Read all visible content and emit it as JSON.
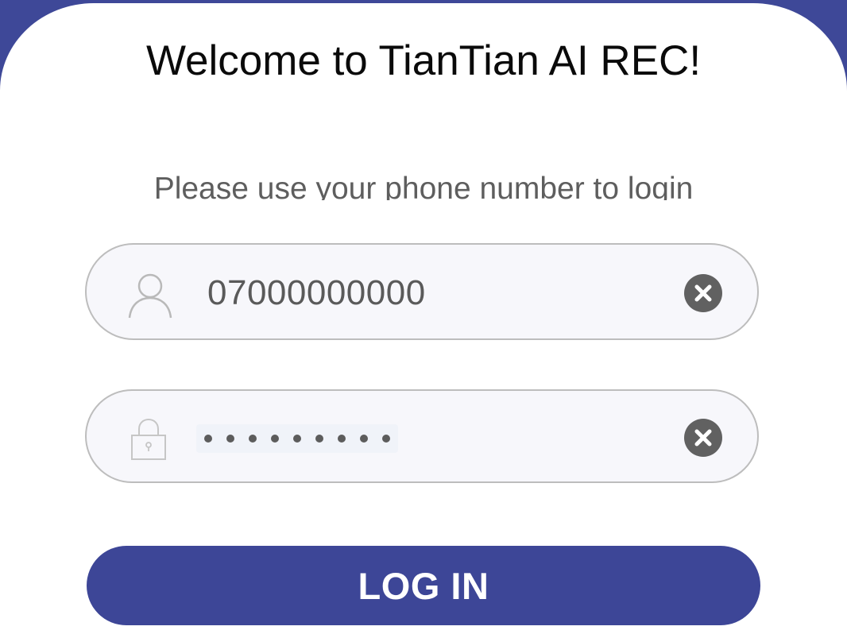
{
  "header": {
    "title": "Welcome to TianTian AI REC!",
    "subtitle": "Please use your phone number to login"
  },
  "phone_field": {
    "icon": "user-icon",
    "value": "07000000000",
    "clear_icon": "clear-icon"
  },
  "password_field": {
    "icon": "lock-icon",
    "masked_value": "•••••••••",
    "mask_length": 9,
    "clear_icon": "clear-icon"
  },
  "login_button": {
    "label": "LOG IN"
  },
  "colors": {
    "brand": "#3d4697",
    "background": "#3e4898",
    "card": "#ffffff",
    "field_background": "#f7f7fb",
    "field_border": "#bdbdbd",
    "clear_button": "#616161"
  }
}
